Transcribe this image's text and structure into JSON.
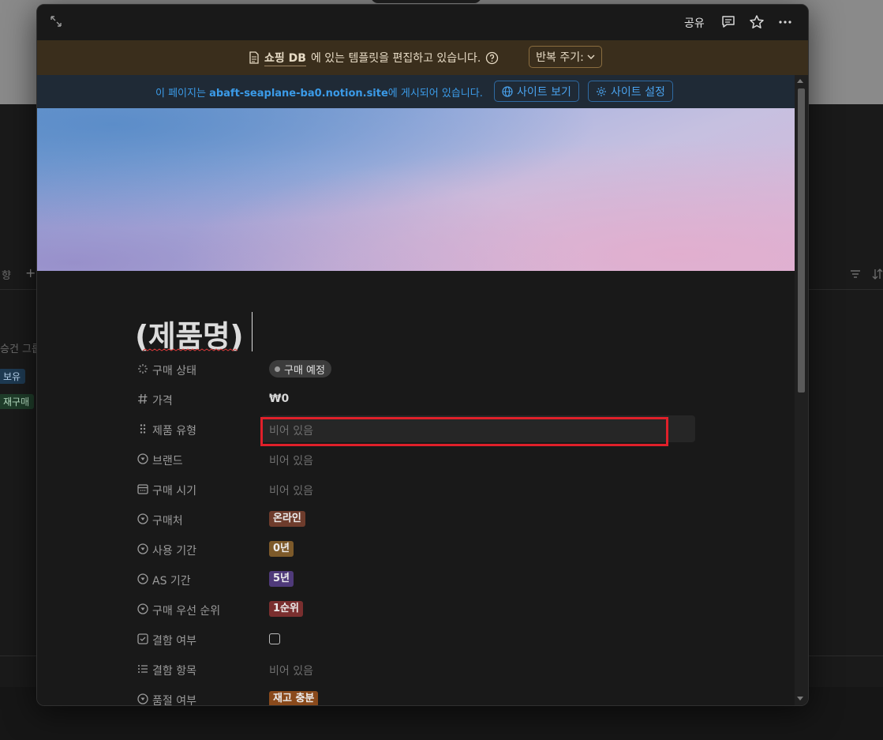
{
  "background": {
    "left_texts": [
      "향",
      "+",
      "승건 그룹",
      "보유",
      "재구매"
    ],
    "right_icons": [
      "filter-icon",
      "sort-icon"
    ]
  },
  "topbar": {
    "share_label": "공유",
    "icons": [
      "expand-icon",
      "comment-icon",
      "star-icon",
      "more-icon"
    ]
  },
  "template_banner": {
    "db_name": "쇼핑 DB",
    "message": "에 있는 템플릿을 편집하고 있습니다.",
    "repeat_label": "반복 주기:"
  },
  "site_banner": {
    "prefix": "이 페이지는 ",
    "site": "abaft-seaplane-ba0.notion.site",
    "suffix": "에 게시되어 있습니다.",
    "view_site": "사이트 보기",
    "site_settings": "사이트 설정"
  },
  "page": {
    "title": "(제품명)"
  },
  "properties": [
    {
      "label": "구매 상태",
      "icon": "status-icon",
      "type": "status",
      "value": "구매 예정"
    },
    {
      "label": "가격",
      "icon": "number-icon",
      "type": "text",
      "value": "₩0"
    },
    {
      "label": "제품 유형",
      "icon": "multiselect-icon",
      "type": "empty",
      "value": "비어 있음"
    },
    {
      "label": "브랜드",
      "icon": "select-icon",
      "type": "empty",
      "value": "비어 있음"
    },
    {
      "label": "구매 시기",
      "icon": "calendar-icon",
      "type": "empty",
      "value": "비어 있음"
    },
    {
      "label": "구매처",
      "icon": "select-icon",
      "type": "tag",
      "value": "온라인",
      "color": "#6e3c2c"
    },
    {
      "label": "사용 기간",
      "icon": "select-icon",
      "type": "tag",
      "value": "0년",
      "color": "#7d5a2a"
    },
    {
      "label": "AS 기간",
      "icon": "select-icon",
      "type": "tag",
      "value": "5년",
      "color": "#4f3a7a"
    },
    {
      "label": "구매 우선 순위",
      "icon": "select-icon",
      "type": "tag",
      "value": "1순위",
      "color": "#7a2f2f"
    },
    {
      "label": "결함 여부",
      "icon": "checkbox-icon",
      "type": "checkbox",
      "value": ""
    },
    {
      "label": "결함 항목",
      "icon": "list-icon",
      "type": "empty",
      "value": "비어 있음"
    },
    {
      "label": "품절 여부",
      "icon": "select-icon",
      "type": "tag",
      "value": "재고 충분",
      "color": "#8a4a1c"
    }
  ]
}
